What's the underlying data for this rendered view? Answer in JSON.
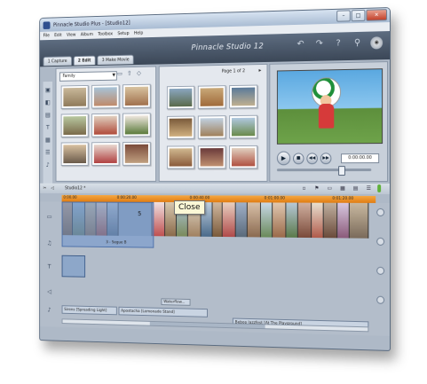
{
  "window": {
    "title": "Pinnacle Studio Plus - [Studio12]",
    "buttons": [
      "–",
      "□",
      "✕"
    ]
  },
  "menu": [
    "File",
    "Edit",
    "View",
    "Album",
    "Toolbox",
    "Setup",
    "Help"
  ],
  "header": {
    "brand": "Pinnacle Studio 12",
    "icons": [
      "undo-icon",
      "redo-icon",
      "help-icon",
      "bulb-icon",
      "disc-icon"
    ]
  },
  "tabs": [
    {
      "label": "1 Capture",
      "active": false
    },
    {
      "label": "2 Edit",
      "active": true
    },
    {
      "label": "3 Make Movie",
      "active": false
    }
  ],
  "album": {
    "selected": "Family",
    "page_text": "Page 1 of 2"
  },
  "preview": {
    "timecode": "0:00:00.00"
  },
  "timeline": {
    "project_name": "Studio12 *",
    "ruler_ticks": [
      "0:00.00",
      "0:00:20.00",
      "0:00:40.00",
      "0:01:00.00",
      "0:01:20.00"
    ]
  },
  "tracks": {
    "segue_label": "3 - Segue B",
    "clip_number": "5",
    "fx_label": "Waterflow...",
    "audio_clips": [
      "Sirens [Spreading Light]",
      "Apostacha [Lemonade Stand]",
      "Bebop Jazzfest [At The Playground]"
    ]
  },
  "tooltip": {
    "text": "Close"
  }
}
